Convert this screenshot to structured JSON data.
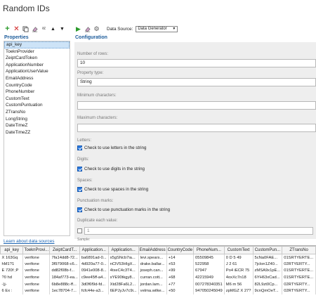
{
  "window": {
    "title": "Random IDs"
  },
  "left_toolbar": {
    "icons": [
      "plus-icon",
      "delete-icon",
      "copy-icon",
      "eraser-icon",
      "sort-icon",
      "arrow-up-icon",
      "arrow-down-icon"
    ]
  },
  "properties": {
    "header": "Properties",
    "items": [
      {
        "label": "api_key",
        "selected": true
      },
      {
        "label": "ToeknProvider"
      },
      {
        "label": "ZeiptCardToken"
      },
      {
        "label": "ApplicationNumber"
      },
      {
        "label": "ApplicationUserValue"
      },
      {
        "label": "EmailAddress"
      },
      {
        "label": "CountryCode"
      },
      {
        "label": "PhoneNumber"
      },
      {
        "label": "CustomText"
      },
      {
        "label": "CustomPuntuation"
      },
      {
        "label": "ZTransNo"
      },
      {
        "label": "LongString"
      },
      {
        "label": "DateTimeZ"
      },
      {
        "label": "DateTimeZZ"
      }
    ],
    "learn_link": "Learn about data sources"
  },
  "right_toolbar": {
    "data_source_label": "Data Source:",
    "data_source_value": "Data Generator"
  },
  "configuration": {
    "header": "Configuration",
    "number_of_rows_label": "Number of rows:",
    "number_of_rows_value": "10",
    "property_type_label": "Property type:",
    "property_type_value": "String",
    "min_chars_label": "Minimum characters:",
    "min_chars_value": "",
    "max_chars_label": "Maximum characters:",
    "max_chars_value": "",
    "letters_label": "Letters:",
    "letters_check": "Check to use letters in the string",
    "digits_label": "Digits:",
    "digits_check": "Check to use digits in the string",
    "spaces_label": "Spaces:",
    "spaces_check": "Check to use spaces in the string",
    "punct_label": "Punctuation marks:",
    "punct_check": "Check to use punctuation marks in the string",
    "duplicate_label": "Duplicate each value:",
    "duplicate_value": "1",
    "sample_label": "Sample:"
  },
  "grid": {
    "columns": [
      "api_key",
      "ToeknProvi...",
      "ZeiptCardT...",
      "Application...",
      "Application...",
      "EmailAddress",
      "CountryCode",
      "PhoneNum...",
      "CustomText",
      "CustomPun...",
      "ZTransNo"
    ],
    "rows": [
      [
        "X 163Gq",
        "verifone",
        "7fa14dd8-72...",
        "ba6891ad-0...",
        "x5gSNcb7ia...",
        "levi.spears...",
        "+14",
        "05509845",
        "0 D 5 49",
        "5cNa0FAE...",
        "01SRTYERTE..."
      ],
      [
        "hM1?1",
        "verifone",
        "3f979068-c6...",
        "4d920a77-0...",
        "nClV53HIgX...",
        "drake.ballar...",
        "+53",
        "522958",
        "J 2  61",
        "7jclon1Z40...",
        "02RTYERTY..."
      ],
      [
        "E 720f ;P",
        "verifone",
        "dd82f08b-f...",
        "0941e008-8...",
        "4txeC4c3T4...",
        "joseph.can...",
        "+99",
        "67947",
        "Po4 iECR 75",
        "zMSA9x1pE...",
        "01SRTYERTE..."
      ],
      [
        "?0  hd",
        "verifone",
        "184af773-ea...",
        "c9ee45ff-a4...",
        "sYE90tkgy8...",
        "curran.cott...",
        "+68",
        "42215949",
        "4oxXc7n18",
        "6YH63xCad...",
        "01SRTYERTE..."
      ],
      [
        "-)j-",
        "verifone",
        "6b8e888c-ff...",
        "3d0f6f9d-fd...",
        "Xtd28Fa6L2...",
        "jordan.lam...",
        "+77",
        "007278340351",
        "M6 m 56",
        "82L9zt0Cp...",
        "02RTYERTY..."
      ],
      [
        "6 Ex :",
        "verifone",
        "1ec78704-7...",
        "fcfc44e-a3...",
        "6EPJyJv7c9i...",
        "velma.wilke...",
        "+50",
        "947050245049",
        "zpMGZ X 27?",
        "9cnQmOeT...",
        "02RTYERTY..."
      ]
    ]
  }
}
